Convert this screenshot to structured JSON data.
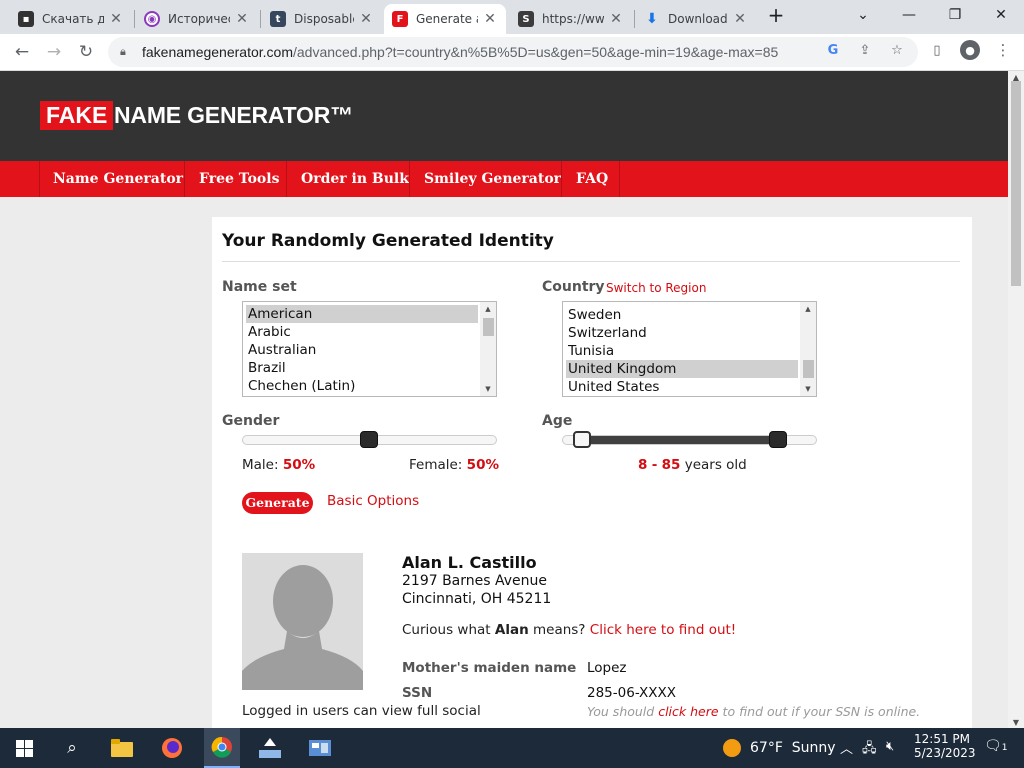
{
  "browser": {
    "tabs": [
      {
        "title": "Скачать ди",
        "icon": "terminal-icon"
      },
      {
        "title": "Историчес",
        "icon": "podcast-icon"
      },
      {
        "title": "Disposable",
        "icon": "tumblr-icon"
      },
      {
        "title": "Generate a",
        "icon": "fake-name-generator-icon"
      },
      {
        "title": "https://ww",
        "icon": "s-app-icon"
      },
      {
        "title": "Downloads",
        "icon": "download-icon"
      }
    ],
    "url_host": "fakenamegenerator.com",
    "url_rest": "/advanced.php?t=country&n%5B%5D=us&gen=50&age-min=19&age-max=85"
  },
  "site": {
    "logo_fake": "FAKE",
    "logo_rest": "NAME GENERATOR™",
    "nav": [
      "Name Generator",
      "Free Tools",
      "Order in Bulk",
      "Smiley Generator",
      "FAQ"
    ]
  },
  "form": {
    "title": "Your Randomly Generated Identity",
    "name_set_label": "Name set",
    "name_sets": [
      "American",
      "Arabic",
      "Australian",
      "Brazil",
      "Chechen (Latin)"
    ],
    "name_set_selected": "American",
    "country_label": "Country",
    "switch_region": "Switch to Region",
    "countries": [
      "Sweden",
      "Switzerland",
      "Tunisia",
      "United Kingdom",
      "United States"
    ],
    "country_selected": "United Kingdom",
    "gender_label": "Gender",
    "male_label": "Male:",
    "male_value": "50%",
    "female_label": "Female:",
    "female_value": "50%",
    "gender_male_percent": 50,
    "age_label": "Age",
    "age_min": "8",
    "age_dash": "-",
    "age_max": "85",
    "age_suffix": "years old",
    "generate_label": "Generate",
    "basic_options_label": "Basic Options"
  },
  "identity": {
    "name": "Alan L. Castillo",
    "street": "2197 Barnes Avenue",
    "city": "Cincinnati, OH 45211",
    "curious_prefix": "Curious what",
    "first_name": "Alan",
    "curious_suffix": "means?",
    "curious_link": "Click here to find out!",
    "maiden_label": "Mother's maiden name",
    "maiden_value": "Lopez",
    "ssn_label": "SSN",
    "ssn_value": "285-06-XXXX",
    "ssn_note_pre": "You should",
    "ssn_note_link": "click here",
    "ssn_note_post": "to find out if your SSN is online.",
    "logged_in_text": "Logged in users can view full social"
  },
  "taskbar": {
    "weather_temp": "67°F",
    "weather_text": "Sunny",
    "time": "12:51 PM",
    "date": "5/23/2023",
    "notifications": "1"
  }
}
